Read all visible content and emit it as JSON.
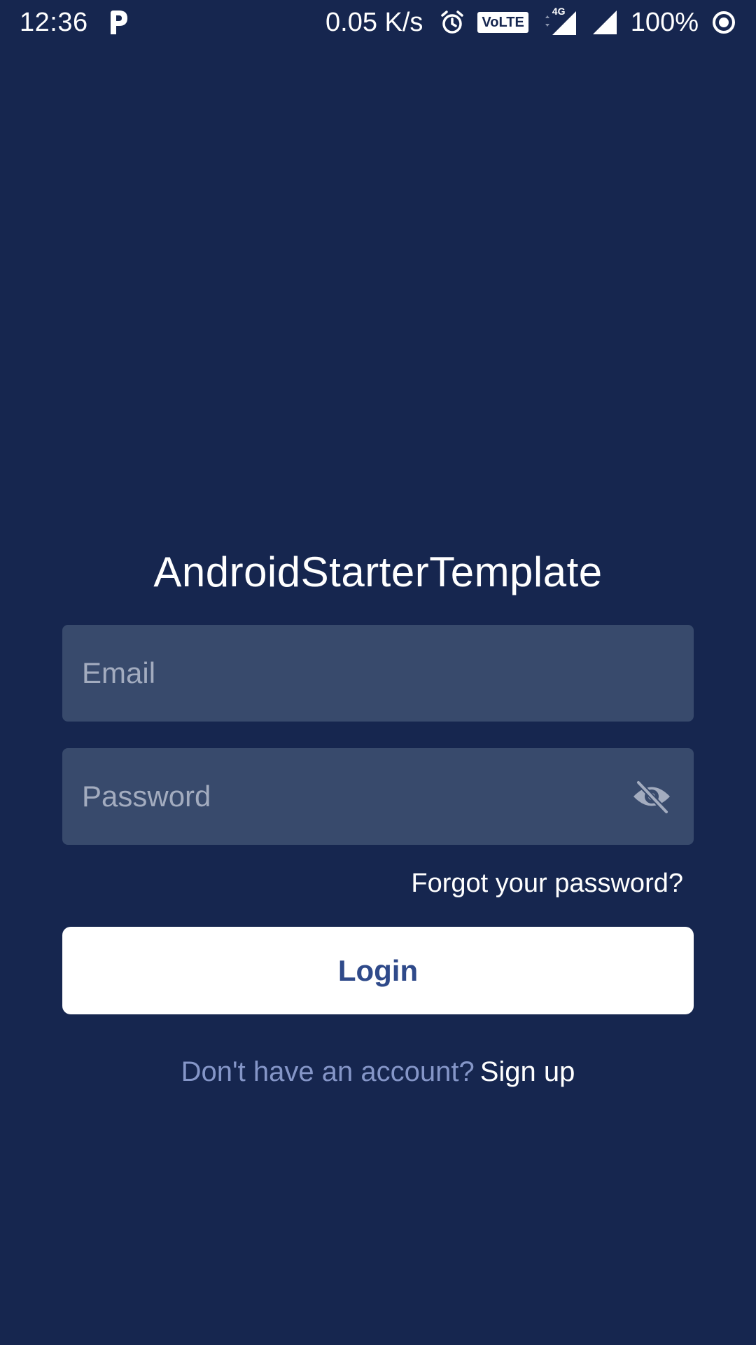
{
  "status_bar": {
    "time": "12:36",
    "network_speed": "0.05 K/s",
    "volte_label": "VoLTE",
    "network_type": "4G",
    "battery": "100%",
    "icons": [
      "parking-notification-icon",
      "alarm-icon",
      "signal-4g-icon",
      "signal-icon",
      "sync-icon"
    ]
  },
  "app": {
    "title": "AndroidStarterTemplate"
  },
  "form": {
    "email_placeholder": "Email",
    "password_placeholder": "Password",
    "password_toggle_icon": "eye-off-icon",
    "forgot_password": "Forgot your password?",
    "login_label": "Login",
    "signup_prompt": "Don't have an account?",
    "signup_label": "Sign up"
  },
  "colors": {
    "background": "#16264f",
    "field_background": "#384a6c",
    "button_background": "#ffffff",
    "button_text": "#2f4a8a",
    "muted_text": "#8596c8"
  }
}
